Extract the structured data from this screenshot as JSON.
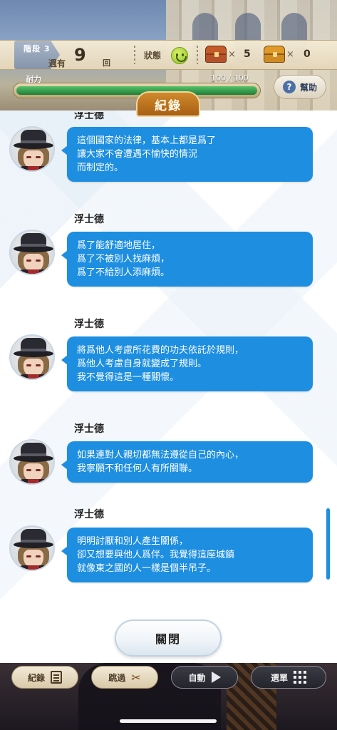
{
  "header": {
    "stage_label": "階段 3",
    "week_label": "週有",
    "week_count": "9",
    "week_unit": "回",
    "state_label": "狀態",
    "state_icon": "smile-icon",
    "chest_red_times": "×",
    "chest_red_count": "5",
    "chest_gold_times": "×",
    "chest_gold_count": "0",
    "stamina_label": "耐力",
    "stamina_value": "100 / 100",
    "stamina_fraction": 1.0,
    "help_label": "幫助"
  },
  "log": {
    "tab_title": "紀錄",
    "entries": [
      {
        "speaker": "浮士德",
        "lines": [
          "這個國家的法律，基本上都是爲了",
          "讓大家不會遭遇不愉快的情況",
          "而制定的。"
        ]
      },
      {
        "speaker": "浮士德",
        "lines": [
          "爲了能舒適地居住，",
          "爲了不被別人找麻煩，",
          "爲了不給別人添麻煩。"
        ]
      },
      {
        "speaker": "浮士德",
        "lines": [
          "將爲他人考慮所花費的功夫依託於規則，",
          "爲他人考慮自身就變成了規則。",
          "我不覺得這是一種關懷。"
        ]
      },
      {
        "speaker": "浮士德",
        "lines": [
          "如果連對人親切都無法遵從自己的內心，",
          "我寧願不和任何人有所關聯。"
        ]
      },
      {
        "speaker": "浮士德",
        "lines": [
          "明明討厭和別人產生關係，",
          "卻又想要與他人爲伴。我覺得這座城鎮",
          "就像東之國的人一樣是個半吊子。"
        ]
      }
    ],
    "close_label": "關閉"
  },
  "bottom_bar": {
    "log_label": "紀錄",
    "skip_label": "跳過",
    "auto_label": "自動",
    "menu_label": "選單"
  },
  "colors": {
    "bubble": "#1d8ee0",
    "tab": "#c07a22",
    "stamina": "#2f9a48"
  }
}
